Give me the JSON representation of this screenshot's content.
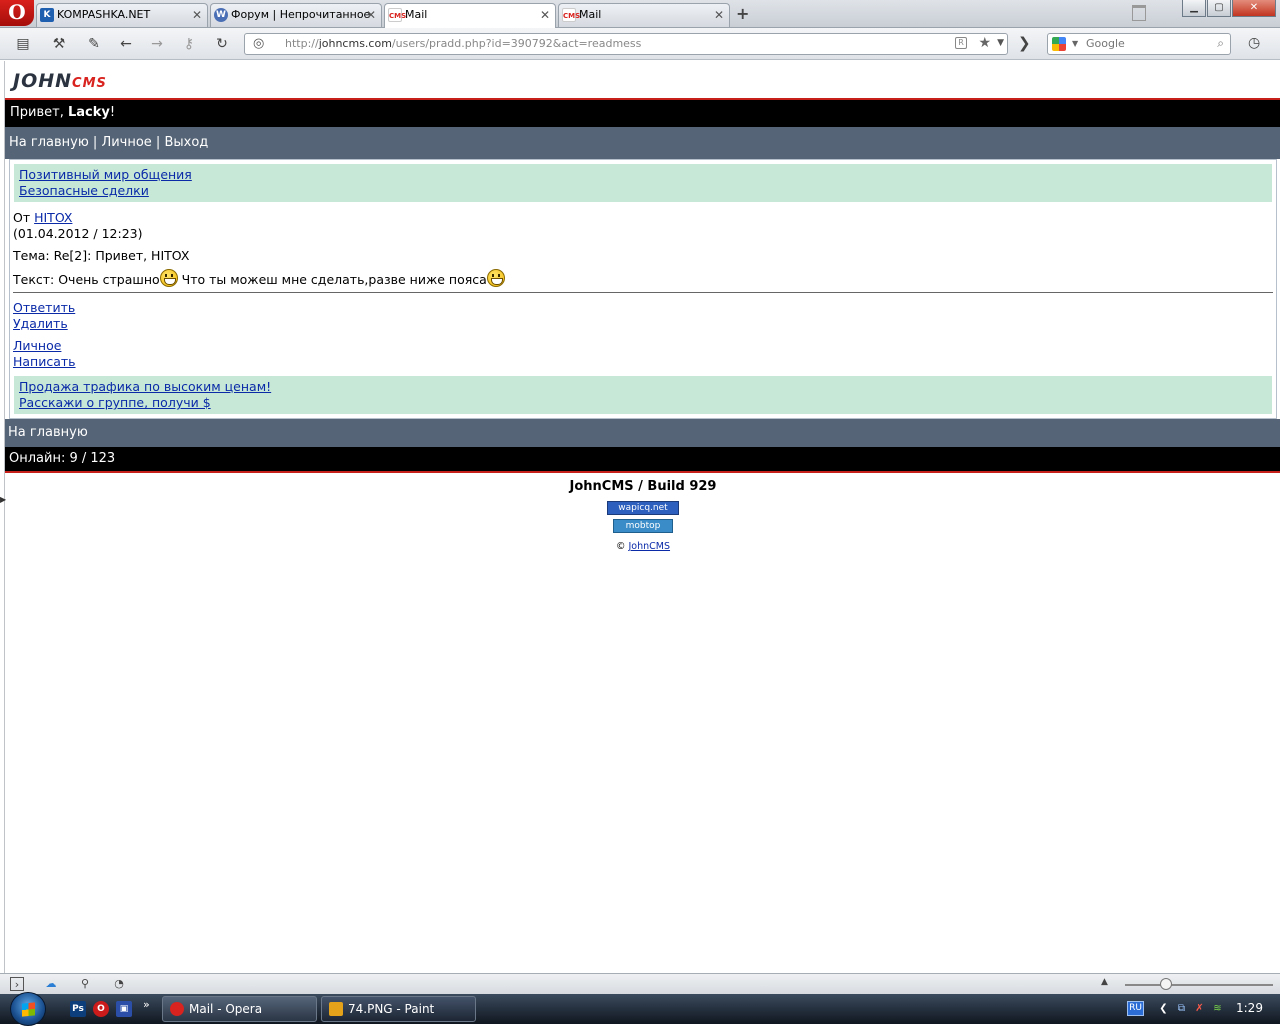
{
  "browser": {
    "tabs": [
      {
        "label": "KOMPASHKA.NET",
        "favicon": "K"
      },
      {
        "label": "Форум | Непрочитанное",
        "favicon": "W"
      },
      {
        "label": "Mail",
        "favicon": "CMS"
      },
      {
        "label": "Mail",
        "favicon": "CMS"
      }
    ],
    "address": {
      "prefix": "http://",
      "host": "johncms.com",
      "path": "/users/pradd.php?id=390792&act=readmess"
    },
    "search_placeholder": "Google"
  },
  "page": {
    "logo_main": "JOHN",
    "logo_sub": "CMS",
    "greeting_prefix": "Привет, ",
    "greeting_user": "Lacky",
    "greeting_suffix": "!",
    "topnav": {
      "home": "На главную",
      "personal": "Личное",
      "logout": "Выход",
      "separator": " | "
    },
    "ads_top": [
      "Позитивный мир общения",
      "Безопасные сделки"
    ],
    "message": {
      "from_label": "От ",
      "from_user": "HITOX",
      "date": "(01.04.2012 / 12:23)",
      "subject_label": "Тема: ",
      "subject": "Re[2]: Привет, HITOX",
      "text_label": "Текст: ",
      "text_part1": "Очень страшно",
      "text_part2": " Что ты можеш мне сделать,разве ниже пояса"
    },
    "actions": {
      "reply": "Ответить",
      "delete": "Удалить",
      "personal": "Личное",
      "write": "Написать"
    },
    "ads_bottom": [
      "Продажа трафика по высоким ценам!",
      "Расскажи о группе, получи $"
    ],
    "bottom_home": "На главную",
    "online": "Онлайн: 9 / 123",
    "build": "JohnCMS / Build 929",
    "counter1": "wapicq.net",
    "counter2": "mobtop",
    "copyright_symbol": "©",
    "copyright_link": "JohnCMS"
  },
  "taskbar": {
    "items": [
      {
        "label": "Mail - Opera"
      },
      {
        "label": "74.PNG - Paint"
      }
    ],
    "lang": "RU",
    "clock": "1:29"
  }
}
